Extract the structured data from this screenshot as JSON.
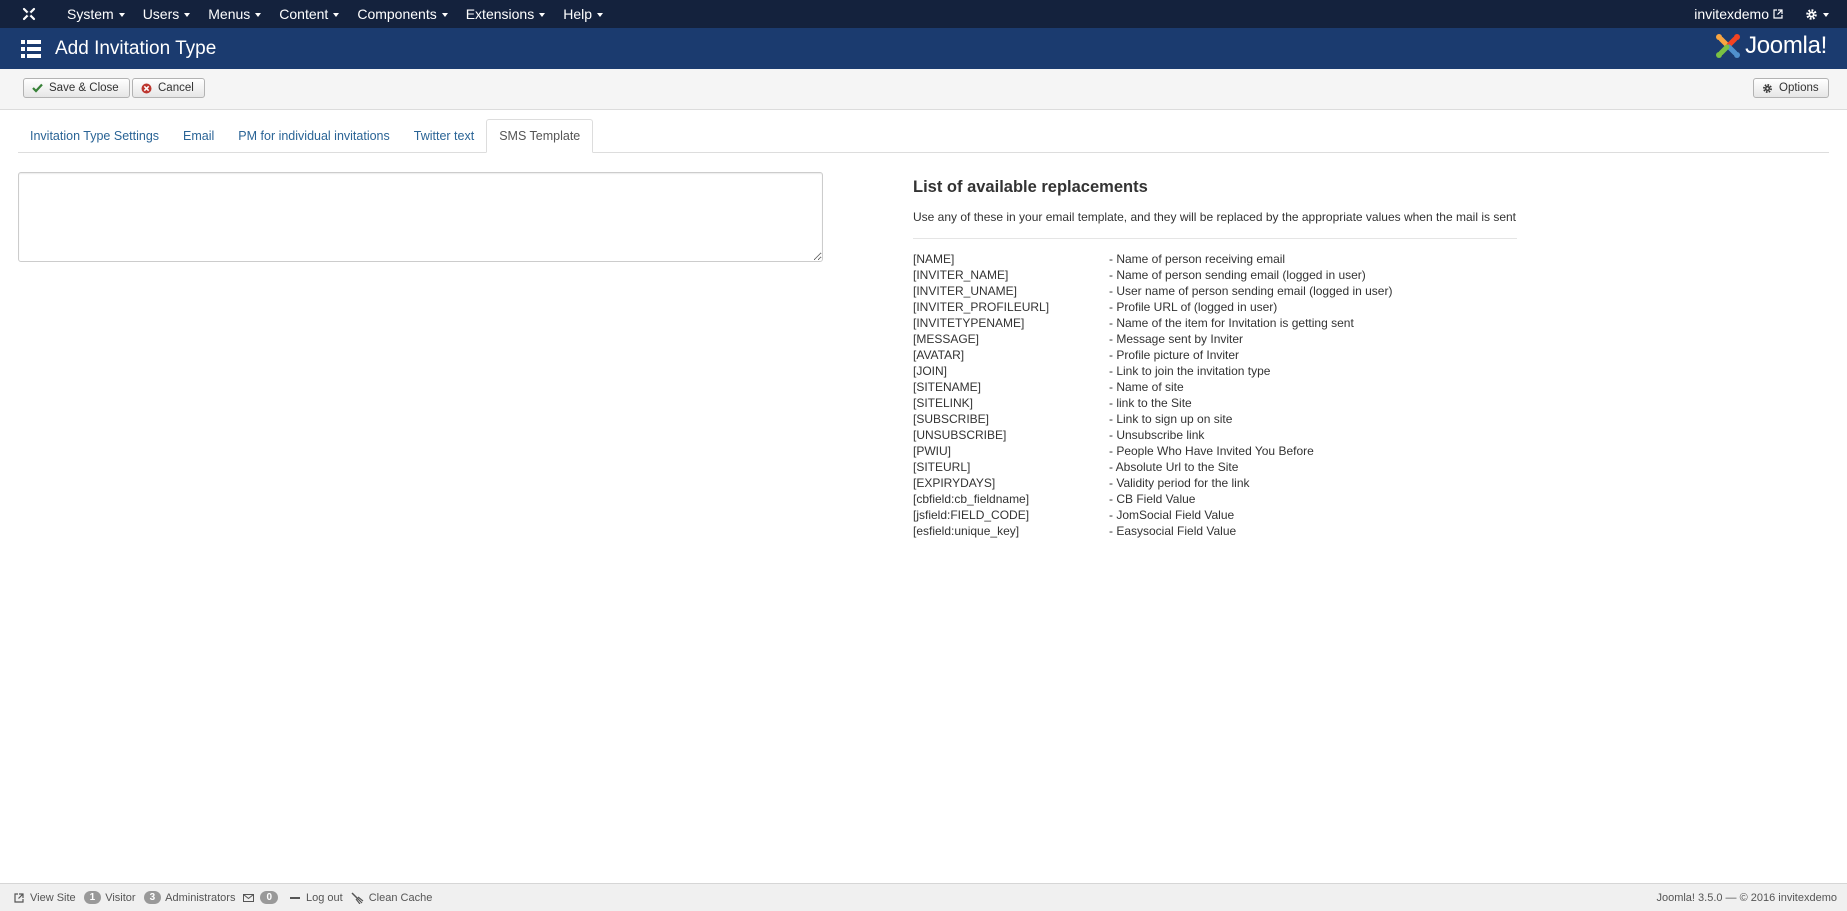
{
  "topnav": {
    "menus": [
      {
        "label": "System"
      },
      {
        "label": "Users"
      },
      {
        "label": "Menus"
      },
      {
        "label": "Content"
      },
      {
        "label": "Components"
      },
      {
        "label": "Extensions"
      },
      {
        "label": "Help"
      }
    ],
    "site_link": "invitexdemo"
  },
  "header": {
    "title": "Add Invitation Type",
    "logo_text": "Joomla!"
  },
  "toolbar": {
    "save_close_label": "Save & Close",
    "cancel_label": "Cancel",
    "options_label": "Options"
  },
  "tabs": [
    {
      "label": "Invitation Type Settings",
      "active": false
    },
    {
      "label": "Email",
      "active": false
    },
    {
      "label": "PM for individual invitations",
      "active": false
    },
    {
      "label": "Twitter text",
      "active": false
    },
    {
      "label": "SMS Template",
      "active": true
    }
  ],
  "sms_template": {
    "value": ""
  },
  "replacements": {
    "heading": "List of available replacements",
    "description": "Use any of these in your email template, and they will be replaced by the appropriate values when the mail is sent",
    "items": [
      {
        "code": "[NAME]",
        "desc": "- Name of person receiving email"
      },
      {
        "code": "[INVITER_NAME]",
        "desc": "- Name of person sending email (logged in user)"
      },
      {
        "code": "[INVITER_UNAME]",
        "desc": "- User name of person sending email (logged in user)"
      },
      {
        "code": "[INVITER_PROFILEURL]",
        "desc": "- Profile URL of (logged in user)"
      },
      {
        "code": "[INVITETYPENAME]",
        "desc": "- Name of the item for Invitation is getting sent"
      },
      {
        "code": "[MESSAGE]",
        "desc": "- Message sent by Inviter"
      },
      {
        "code": "[AVATAR]",
        "desc": "- Profile picture of Inviter"
      },
      {
        "code": "[JOIN]",
        "desc": "- Link to join the invitation type"
      },
      {
        "code": "[SITENAME]",
        "desc": "- Name of site"
      },
      {
        "code": "[SITELINK]",
        "desc": "- link to the Site"
      },
      {
        "code": "[SUBSCRIBE]",
        "desc": "- Link to sign up on site"
      },
      {
        "code": "[UNSUBSCRIBE]",
        "desc": "- Unsubscribe link"
      },
      {
        "code": "[PWIU]",
        "desc": "- People Who Have Invited You Before"
      },
      {
        "code": "[SITEURL]",
        "desc": "- Absolute Url to the Site"
      },
      {
        "code": "[EXPIRYDAYS]",
        "desc": "- Validity period for the link"
      },
      {
        "code": "[cbfield:cb_fieldname]",
        "desc": "- CB Field Value"
      },
      {
        "code": "[jsfield:FIELD_CODE]",
        "desc": "- JomSocial Field Value"
      },
      {
        "code": "[esfield:unique_key]",
        "desc": "- Easysocial Field Value"
      }
    ]
  },
  "footer": {
    "view_site": "View Site",
    "visitor_count": "1",
    "visitor_label": "Visitor",
    "admin_count": "3",
    "admin_label": "Administrators",
    "message_count": "0",
    "logout_label": "Log out",
    "clean_cache_label": "Clean Cache",
    "version_text": "Joomla! 3.5.0  —  © 2016 invitexdemo"
  },
  "colors": {
    "navbar_bg": "#14223d",
    "header_bg": "#1b3b6f",
    "link": "#2a6496"
  }
}
